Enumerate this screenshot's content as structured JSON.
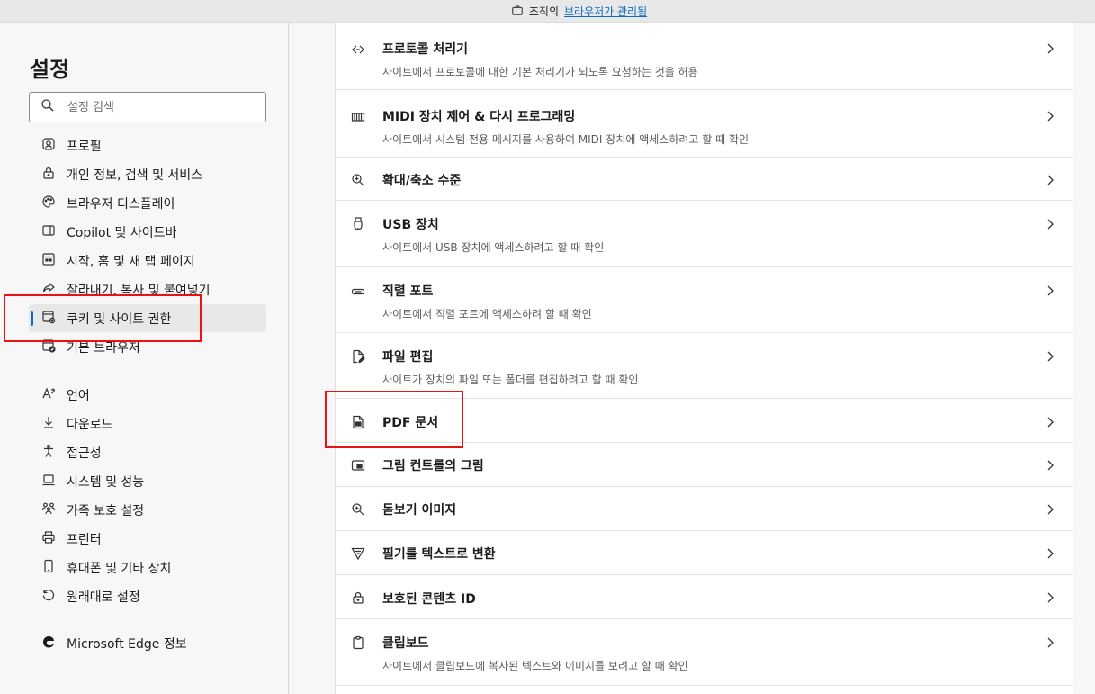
{
  "banner": {
    "prefix": "조직의",
    "link": "브라우저가 관리됨"
  },
  "sidebar": {
    "title": "설정",
    "search_placeholder": "설정 검색",
    "items": [
      {
        "label": "프로필",
        "icon": "profile-icon"
      },
      {
        "label": "개인 정보, 검색 및 서비스",
        "icon": "lock-icon"
      },
      {
        "label": "브라우저 디스플레이",
        "icon": "palette-icon"
      },
      {
        "label": "Copilot 및 사이드바",
        "icon": "sidebar-icon"
      },
      {
        "label": "시작, 홈 및 새 탭 페이지",
        "icon": "home-tab-icon"
      },
      {
        "label": "잘라내기, 복사 및 붙여넣기",
        "icon": "share-icon"
      },
      {
        "label": "쿠키 및 사이트 권한",
        "icon": "cookie-settings-icon",
        "active": true
      },
      {
        "label": "기본 브라우저",
        "icon": "default-browser-icon"
      },
      {
        "label": "언어",
        "icon": "language-icon"
      },
      {
        "label": "다운로드",
        "icon": "download-icon"
      },
      {
        "label": "접근성",
        "icon": "accessibility-icon"
      },
      {
        "label": "시스템 및 성능",
        "icon": "laptop-icon"
      },
      {
        "label": "가족 보호 설정",
        "icon": "family-icon"
      },
      {
        "label": "프린터",
        "icon": "printer-icon"
      },
      {
        "label": "휴대폰 및 기타 장치",
        "icon": "phone-icon"
      },
      {
        "label": "원래대로 설정",
        "icon": "reset-icon"
      },
      {
        "label": "Microsoft Edge 정보",
        "icon": "edge-logo-icon"
      }
    ]
  },
  "permissions": [
    {
      "title": "프로토콜 처리기",
      "desc": "사이트에서 프로토콜에 대한 기본 처리기가 되도록 요청하는 것을 허용",
      "icon": "protocol-icon"
    },
    {
      "title": "MIDI 장치 제어 & 다시 프로그래밍",
      "desc": "사이트에서 시스템 전용 메시지를 사용하여 MIDI 장치에 액세스하려고 할 때 확인",
      "icon": "midi-keyboard-icon"
    },
    {
      "title": "확대/축소 수준",
      "desc": "",
      "icon": "zoom-icon"
    },
    {
      "title": "USB 장치",
      "desc": "사이트에서 USB 장치에 액세스하려고 할 때 확인",
      "icon": "usb-icon"
    },
    {
      "title": "직렬 포트",
      "desc": "사이트에서 직렬 포트에 액세스하려 할 때 확인",
      "icon": "serial-port-icon"
    },
    {
      "title": "파일 편집",
      "desc": "사이트가 장치의 파일 또는 폴더를 편집하려고 할 때 확인",
      "icon": "file-edit-icon"
    },
    {
      "title": "PDF 문서",
      "desc": "",
      "icon": "pdf-document-icon"
    },
    {
      "title": "그림 컨트롤의 그림",
      "desc": "",
      "icon": "picture-in-picture-icon"
    },
    {
      "title": "돋보기 이미지",
      "desc": "",
      "icon": "magnifier-icon"
    },
    {
      "title": "필기를 텍스트로 변환",
      "desc": "",
      "icon": "handwriting-icon"
    },
    {
      "title": "보호된 콘텐츠 ID",
      "desc": "",
      "icon": "protected-content-icon"
    },
    {
      "title": "클립보드",
      "desc": "사이트에서 클립보드에 복사된 텍스트와 이미지를 보려고 할 때 확인",
      "icon": "clipboard-icon"
    }
  ],
  "colors": {
    "accent": "#0f6cbd",
    "highlight": "#ee1111"
  }
}
